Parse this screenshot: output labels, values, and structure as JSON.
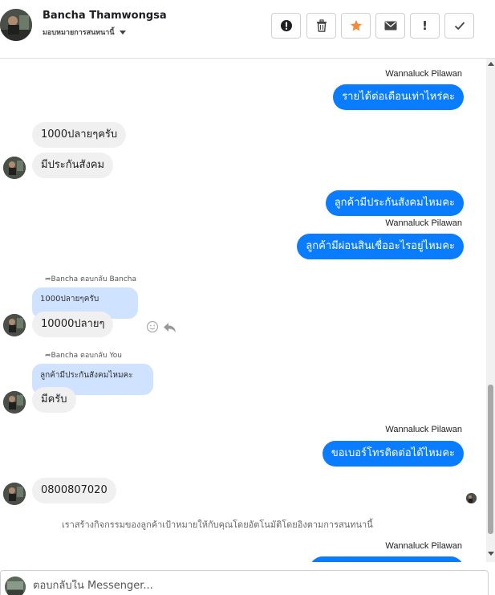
{
  "header": {
    "name": "Bancha Thamwongsa",
    "subtitle": "มอบหมายการสนทนานี้",
    "actions": [
      {
        "icon": "alert-circle-icon"
      },
      {
        "icon": "trash-icon"
      },
      {
        "icon": "star-icon",
        "color": "#f5893b"
      },
      {
        "icon": "envelope-icon"
      },
      {
        "icon": "exclamation-icon",
        "label": "!"
      },
      {
        "icon": "checkmark-icon"
      }
    ]
  },
  "messages": [
    {
      "sender": "Wannaluck Pilawan",
      "text": "รายได้ต่อเดือนเท่าไหร่คะ",
      "dir": "out"
    },
    {
      "text": "1000ปลายๆครับ",
      "dir": "in"
    },
    {
      "text": "มีประกันสังคม",
      "dir": "in"
    },
    {
      "text": "ลูกค้ามีประกันสังคมไหมคะ",
      "dir": "out"
    },
    {
      "sender": "Wannaluck Pilawan",
      "text": "ลูกค้ามีผ่อนสินเชื่ออะไรอยู่ไหมคะ",
      "dir": "out"
    },
    {
      "reply_label": "Bancha ตอบกลับ Bancha",
      "quote": "1000ปลายๆครับ",
      "text": "10000ปลายๆ",
      "dir": "in"
    },
    {
      "reply_label": "Bancha ตอบกลับ You",
      "quote": "ลูกค้ามีประกันสังคมไหมคะ",
      "text": "มีครับ",
      "dir": "in"
    },
    {
      "sender": "Wannaluck Pilawan",
      "text": "ขอเบอร์โทรติดต่อได้ไหมคะ",
      "dir": "out"
    },
    {
      "text": "0800807020",
      "dir": "in"
    },
    {
      "system": "เราสร้างกิจกรรมของลูกค้าเป้าหมายให้กับคุณโดยอัตโนมัติโดยอิงตามการสนทนานี้"
    },
    {
      "sender": "Wannaluck Pilawan",
      "dir": "out"
    }
  ],
  "composer": {
    "placeholder": "ตอบกลับใน Messenger..."
  },
  "colors": {
    "outgoing_bubble": "#0a7cff",
    "incoming_bubble": "#f0f0f0",
    "quote_bubble": "#cfe2ff"
  }
}
